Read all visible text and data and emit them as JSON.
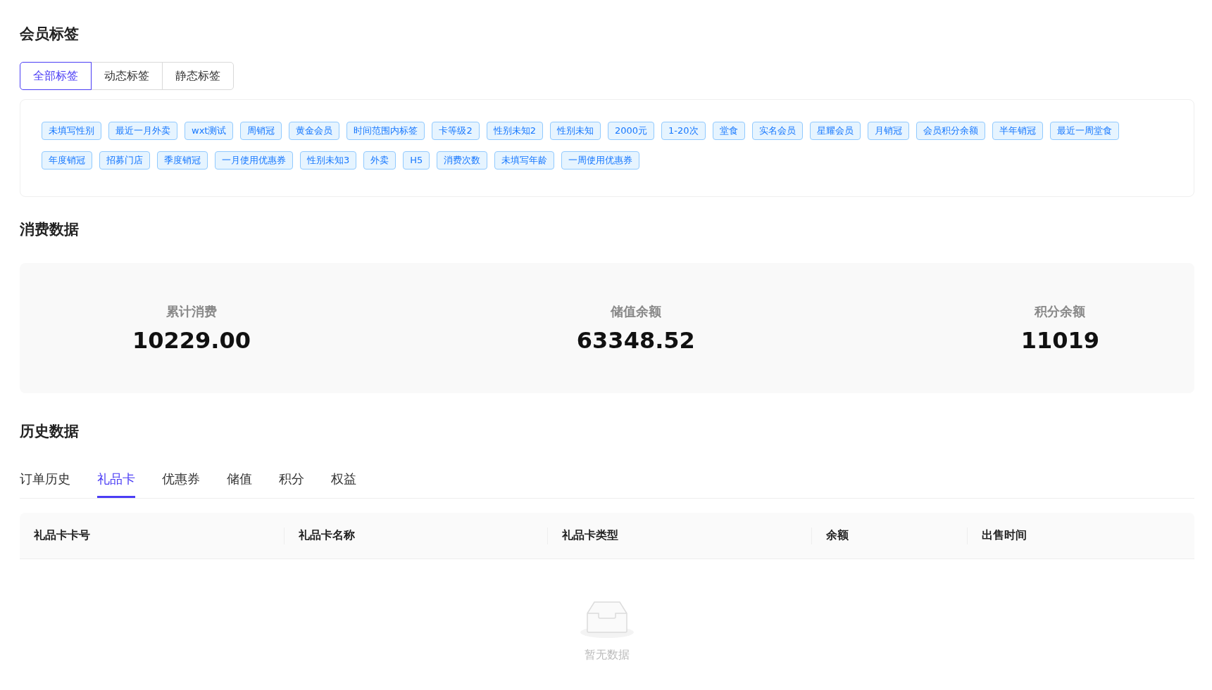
{
  "member_tags": {
    "title": "会员标签",
    "filter_tabs": [
      {
        "label": "全部标签",
        "selected": true
      },
      {
        "label": "动态标签",
        "selected": false
      },
      {
        "label": "静态标签",
        "selected": false
      }
    ],
    "tags": [
      "未填写性别",
      "最近一月外卖",
      "wxt测试",
      "周销冠",
      "黄金会员",
      "时间范围内标签",
      "卡等级2",
      "性别未知2",
      "性别未知",
      "2000元",
      "1-20次",
      "堂食",
      "实名会员",
      "星耀会员",
      "月销冠",
      "会员积分余额",
      "半年销冠",
      "最近一周堂食",
      "年度销冠",
      "招募门店",
      "季度销冠",
      "一月使用优惠券",
      "性别未知3",
      "外卖",
      "H5",
      "消费次数",
      "未填写年龄",
      "一周使用优惠券"
    ]
  },
  "consumption": {
    "title": "消费数据",
    "stats": [
      {
        "label": "累计消费",
        "value": "10229.00"
      },
      {
        "label": "储值余额",
        "value": "63348.52"
      },
      {
        "label": "积分余额",
        "value": "11019"
      }
    ]
  },
  "history": {
    "title": "历史数据",
    "tabs": [
      {
        "label": "订单历史",
        "selected": false
      },
      {
        "label": "礼品卡",
        "selected": true
      },
      {
        "label": "优惠券",
        "selected": false
      },
      {
        "label": "储值",
        "selected": false
      },
      {
        "label": "积分",
        "selected": false
      },
      {
        "label": "权益",
        "selected": false
      }
    ],
    "table": {
      "columns": [
        "礼品卡卡号",
        "礼品卡名称",
        "礼品卡类型",
        "余额",
        "出售时间"
      ],
      "empty_text": "暂无数据"
    }
  }
}
